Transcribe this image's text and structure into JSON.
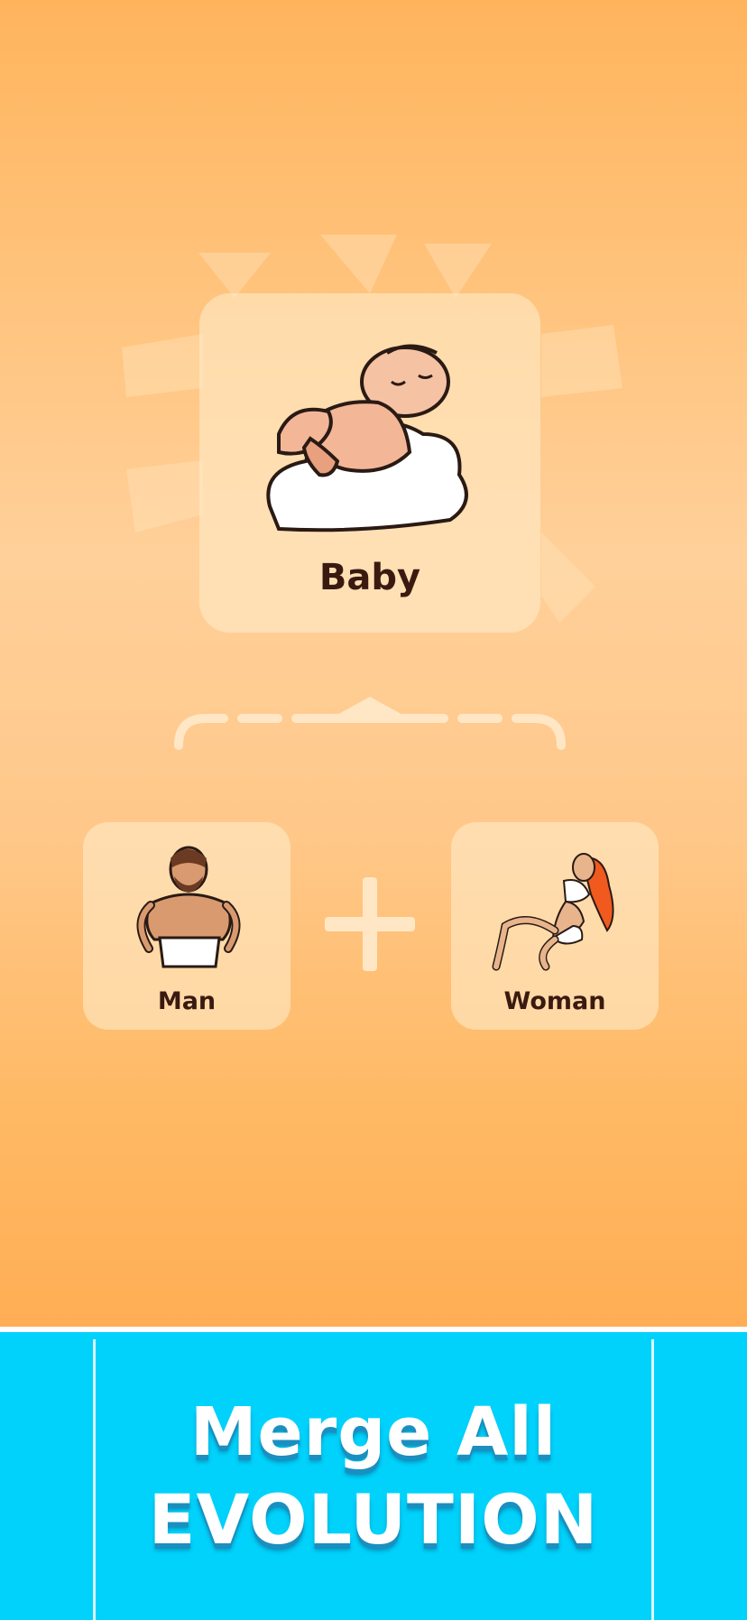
{
  "result": {
    "label": "Baby",
    "icon": "baby-on-cloud-icon"
  },
  "ingredients": [
    {
      "label": "Man",
      "icon": "caveman-icon"
    },
    {
      "label": "Woman",
      "icon": "woman-sitting-icon"
    }
  ],
  "operator": {
    "icon": "plus-icon"
  },
  "banner": {
    "line1": "Merge All",
    "line2": "EVOLUTION"
  },
  "colors": {
    "background_top": "#ffb45c",
    "card": "#ffe6c0",
    "label_text": "#3a1a10",
    "banner": "#00d2fb",
    "banner_text": "#ffffff"
  }
}
